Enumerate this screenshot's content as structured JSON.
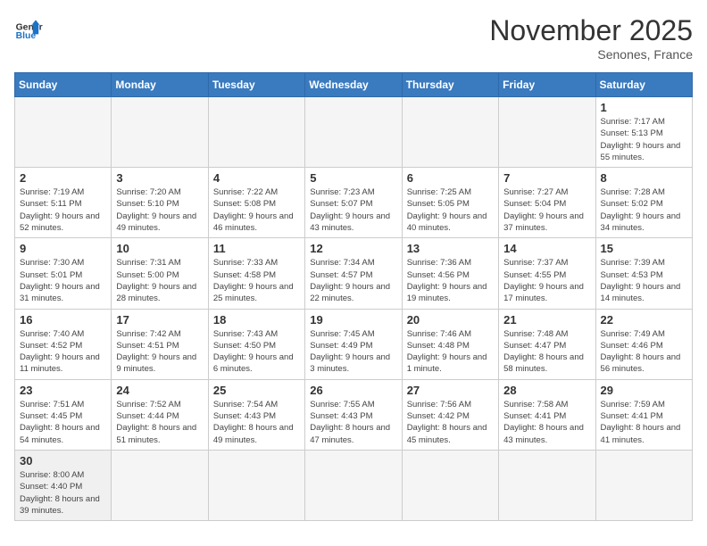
{
  "header": {
    "logo_general": "General",
    "logo_blue": "Blue",
    "month_title": "November 2025",
    "location": "Senones, France"
  },
  "weekdays": [
    "Sunday",
    "Monday",
    "Tuesday",
    "Wednesday",
    "Thursday",
    "Friday",
    "Saturday"
  ],
  "weeks": [
    [
      {
        "day": "",
        "info": ""
      },
      {
        "day": "",
        "info": ""
      },
      {
        "day": "",
        "info": ""
      },
      {
        "day": "",
        "info": ""
      },
      {
        "day": "",
        "info": ""
      },
      {
        "day": "",
        "info": ""
      },
      {
        "day": "1",
        "info": "Sunrise: 7:17 AM\nSunset: 5:13 PM\nDaylight: 9 hours and 55 minutes."
      }
    ],
    [
      {
        "day": "2",
        "info": "Sunrise: 7:19 AM\nSunset: 5:11 PM\nDaylight: 9 hours and 52 minutes."
      },
      {
        "day": "3",
        "info": "Sunrise: 7:20 AM\nSunset: 5:10 PM\nDaylight: 9 hours and 49 minutes."
      },
      {
        "day": "4",
        "info": "Sunrise: 7:22 AM\nSunset: 5:08 PM\nDaylight: 9 hours and 46 minutes."
      },
      {
        "day": "5",
        "info": "Sunrise: 7:23 AM\nSunset: 5:07 PM\nDaylight: 9 hours and 43 minutes."
      },
      {
        "day": "6",
        "info": "Sunrise: 7:25 AM\nSunset: 5:05 PM\nDaylight: 9 hours and 40 minutes."
      },
      {
        "day": "7",
        "info": "Sunrise: 7:27 AM\nSunset: 5:04 PM\nDaylight: 9 hours and 37 minutes."
      },
      {
        "day": "8",
        "info": "Sunrise: 7:28 AM\nSunset: 5:02 PM\nDaylight: 9 hours and 34 minutes."
      }
    ],
    [
      {
        "day": "9",
        "info": "Sunrise: 7:30 AM\nSunset: 5:01 PM\nDaylight: 9 hours and 31 minutes."
      },
      {
        "day": "10",
        "info": "Sunrise: 7:31 AM\nSunset: 5:00 PM\nDaylight: 9 hours and 28 minutes."
      },
      {
        "day": "11",
        "info": "Sunrise: 7:33 AM\nSunset: 4:58 PM\nDaylight: 9 hours and 25 minutes."
      },
      {
        "day": "12",
        "info": "Sunrise: 7:34 AM\nSunset: 4:57 PM\nDaylight: 9 hours and 22 minutes."
      },
      {
        "day": "13",
        "info": "Sunrise: 7:36 AM\nSunset: 4:56 PM\nDaylight: 9 hours and 19 minutes."
      },
      {
        "day": "14",
        "info": "Sunrise: 7:37 AM\nSunset: 4:55 PM\nDaylight: 9 hours and 17 minutes."
      },
      {
        "day": "15",
        "info": "Sunrise: 7:39 AM\nSunset: 4:53 PM\nDaylight: 9 hours and 14 minutes."
      }
    ],
    [
      {
        "day": "16",
        "info": "Sunrise: 7:40 AM\nSunset: 4:52 PM\nDaylight: 9 hours and 11 minutes."
      },
      {
        "day": "17",
        "info": "Sunrise: 7:42 AM\nSunset: 4:51 PM\nDaylight: 9 hours and 9 minutes."
      },
      {
        "day": "18",
        "info": "Sunrise: 7:43 AM\nSunset: 4:50 PM\nDaylight: 9 hours and 6 minutes."
      },
      {
        "day": "19",
        "info": "Sunrise: 7:45 AM\nSunset: 4:49 PM\nDaylight: 9 hours and 3 minutes."
      },
      {
        "day": "20",
        "info": "Sunrise: 7:46 AM\nSunset: 4:48 PM\nDaylight: 9 hours and 1 minute."
      },
      {
        "day": "21",
        "info": "Sunrise: 7:48 AM\nSunset: 4:47 PM\nDaylight: 8 hours and 58 minutes."
      },
      {
        "day": "22",
        "info": "Sunrise: 7:49 AM\nSunset: 4:46 PM\nDaylight: 8 hours and 56 minutes."
      }
    ],
    [
      {
        "day": "23",
        "info": "Sunrise: 7:51 AM\nSunset: 4:45 PM\nDaylight: 8 hours and 54 minutes."
      },
      {
        "day": "24",
        "info": "Sunrise: 7:52 AM\nSunset: 4:44 PM\nDaylight: 8 hours and 51 minutes."
      },
      {
        "day": "25",
        "info": "Sunrise: 7:54 AM\nSunset: 4:43 PM\nDaylight: 8 hours and 49 minutes."
      },
      {
        "day": "26",
        "info": "Sunrise: 7:55 AM\nSunset: 4:43 PM\nDaylight: 8 hours and 47 minutes."
      },
      {
        "day": "27",
        "info": "Sunrise: 7:56 AM\nSunset: 4:42 PM\nDaylight: 8 hours and 45 minutes."
      },
      {
        "day": "28",
        "info": "Sunrise: 7:58 AM\nSunset: 4:41 PM\nDaylight: 8 hours and 43 minutes."
      },
      {
        "day": "29",
        "info": "Sunrise: 7:59 AM\nSunset: 4:41 PM\nDaylight: 8 hours and 41 minutes."
      }
    ],
    [
      {
        "day": "30",
        "info": "Sunrise: 8:00 AM\nSunset: 4:40 PM\nDaylight: 8 hours and 39 minutes."
      },
      {
        "day": "",
        "info": ""
      },
      {
        "day": "",
        "info": ""
      },
      {
        "day": "",
        "info": ""
      },
      {
        "day": "",
        "info": ""
      },
      {
        "day": "",
        "info": ""
      },
      {
        "day": "",
        "info": ""
      }
    ]
  ]
}
